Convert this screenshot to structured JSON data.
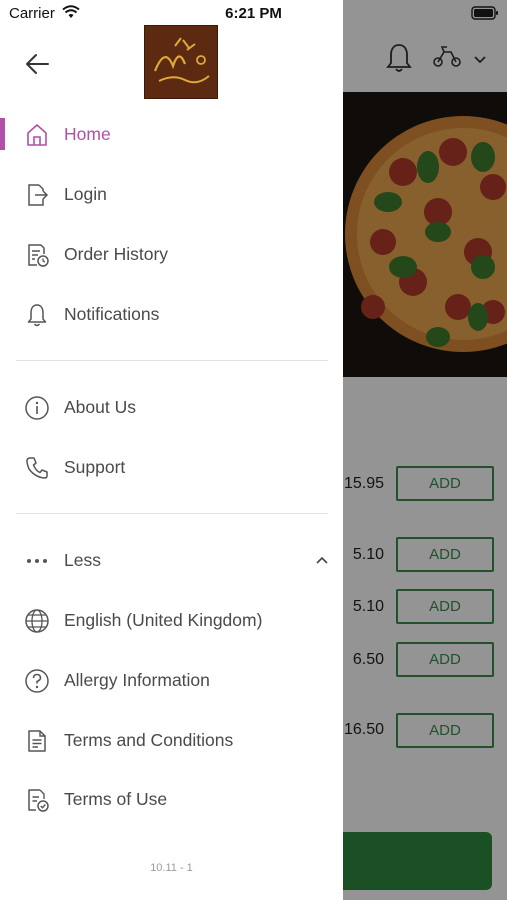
{
  "status_bar": {
    "carrier": "Carrier",
    "time": "6:21 PM"
  },
  "drawer": {
    "logo_alt": "Ali & Do-Nizza",
    "primary_items": [
      {
        "label": "Home",
        "icon": "home-icon",
        "active": true
      },
      {
        "label": "Login",
        "icon": "login-icon",
        "active": false
      },
      {
        "label": "Order History",
        "icon": "order-history-icon",
        "active": false
      },
      {
        "label": "Notifications",
        "icon": "bell-icon",
        "active": false
      }
    ],
    "secondary_items": [
      {
        "label": "About Us",
        "icon": "info-icon"
      },
      {
        "label": "Support",
        "icon": "phone-icon"
      }
    ],
    "more_toggle": {
      "label": "Less",
      "icon": "more-dots-icon",
      "state": "expanded"
    },
    "extra_items": [
      {
        "label": "English (United Kingdom)",
        "icon": "globe-icon"
      },
      {
        "label": "Allergy Information",
        "icon": "question-icon"
      },
      {
        "label": "Terms and Conditions",
        "icon": "document-icon"
      },
      {
        "label": "Terms of Use",
        "icon": "document-check-icon"
      }
    ],
    "version": "10.11 - 1"
  },
  "background": {
    "products": [
      {
        "price": "15.95",
        "button": "ADD"
      },
      {
        "price": "5.10",
        "button": "ADD"
      },
      {
        "price": "5.10",
        "button": "ADD"
      },
      {
        "price": "6.50",
        "button": "ADD"
      },
      {
        "price": "16.50",
        "button": "ADD"
      }
    ]
  },
  "colors": {
    "accent": "#b24fa8",
    "add_button": "#3f8a4f",
    "checkout_bar": "#2e8b3e",
    "logo_bg": "#5b2a10"
  }
}
